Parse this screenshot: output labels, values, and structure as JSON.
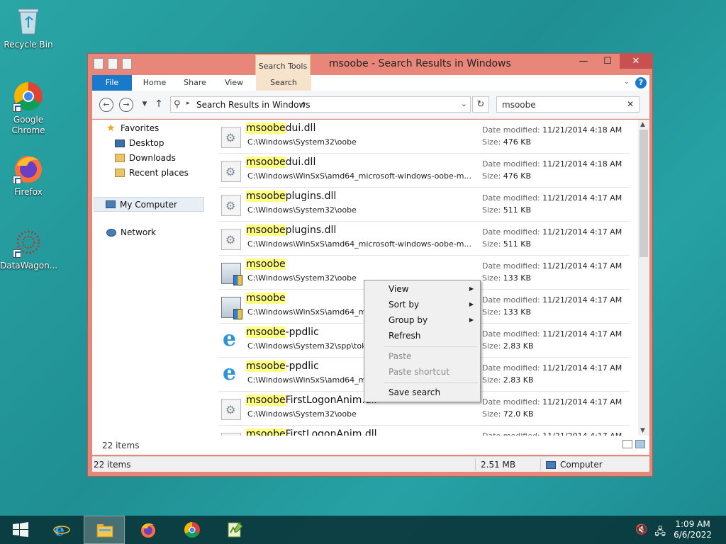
{
  "desktop": {
    "icons": [
      {
        "label": "Recycle Bin"
      },
      {
        "label": "Google Chrome"
      },
      {
        "label": "Firefox"
      },
      {
        "label": "DataWagon..."
      }
    ]
  },
  "window": {
    "title": "msoobe - Search Results in Windows",
    "context_tab_group": "Search Tools",
    "ribbon_tabs": [
      "File",
      "Home",
      "Share",
      "View",
      "Search"
    ],
    "controls": {
      "minimize": "—",
      "maximize": "☐",
      "close": "✕",
      "help": "?"
    }
  },
  "address": {
    "crumb": "Search Results in Windows",
    "separator": "▸"
  },
  "search": {
    "value": "msoobe",
    "clear": "✕"
  },
  "nav": {
    "favorites": "Favorites",
    "desktop": "Desktop",
    "downloads": "Downloads",
    "recent": "Recent places",
    "computer": "My Computer",
    "network": "Network"
  },
  "results": {
    "date_key": "Date modified:",
    "size_key": "Size:",
    "items": [
      {
        "match": "msoobe",
        "rest": "dui.dll",
        "path": "C:\\Windows\\System32\\oobe",
        "date": "11/21/2014 4:18 AM",
        "size": "476 KB",
        "icon": "dll-file-icon"
      },
      {
        "match": "msoobe",
        "rest": "dui.dll",
        "path": "C:\\Windows\\WinSxS\\amd64_microsoft-windows-oobe-m...",
        "date": "11/21/2014 4:18 AM",
        "size": "476 KB",
        "icon": "dll-file-icon"
      },
      {
        "match": "msoobe",
        "rest": "plugins.dll",
        "path": "C:\\Windows\\System32\\oobe",
        "date": "11/21/2014 4:17 AM",
        "size": "511 KB",
        "icon": "dll-file-icon"
      },
      {
        "match": "msoobe",
        "rest": "plugins.dll",
        "path": "C:\\Windows\\WinSxS\\amd64_microsoft-windows-oobe-m...",
        "date": "11/21/2014 4:17 AM",
        "size": "511 KB",
        "icon": "dll-file-icon"
      },
      {
        "match": "msoobe",
        "rest": "",
        "path": "C:\\Windows\\System32\\oobe",
        "date": "11/21/2014 4:17 AM",
        "size": "133 KB",
        "icon": "exe-file-icon"
      },
      {
        "match": "msoobe",
        "rest": "",
        "path": "C:\\Windows\\WinSxS\\amd64_m",
        "date": "11/21/2014 4:17 AM",
        "size": "133 KB",
        "icon": "exe-file-icon"
      },
      {
        "match": "msoobe",
        "rest": "-ppdlic",
        "path": "C:\\Windows\\System32\\spp\\tok",
        "date": "11/21/2014 4:17 AM",
        "size": "2.83 KB",
        "icon": "ie-file-icon"
      },
      {
        "match": "msoobe",
        "rest": "-ppdlic",
        "path": "C:\\Windows\\WinSxS\\amd64_m",
        "date": "11/21/2014 4:17 AM",
        "size": "2.83 KB",
        "icon": "ie-file-icon"
      },
      {
        "match": "msoobe",
        "rest": "FirstLogonAnim.dll",
        "path": "C:\\Windows\\System32\\oobe",
        "date": "11/21/2014 4:17 AM",
        "size": "72.0 KB",
        "icon": "dll-file-icon"
      },
      {
        "match": "msoobe",
        "rest": "FirstLogonAnim.dll",
        "path": "",
        "date": "11/21/2014 4:17 AM",
        "size": "",
        "icon": "dll-file-icon"
      }
    ]
  },
  "footer": {
    "count": "22 items"
  },
  "statusbar": {
    "items": "22 items",
    "size": "2.51 MB",
    "location": "Computer"
  },
  "context_menu": {
    "view": "View",
    "sort_by": "Sort by",
    "group_by": "Group by",
    "refresh": "Refresh",
    "paste": "Paste",
    "paste_shortcut": "Paste shortcut",
    "save_search": "Save search"
  },
  "taskbar": {
    "time": "1:09 AM",
    "date": "6/6/2022"
  },
  "colors": {
    "accent": "#1979ca",
    "window_frame": "#e9867a",
    "highlight": "#ffff80"
  }
}
